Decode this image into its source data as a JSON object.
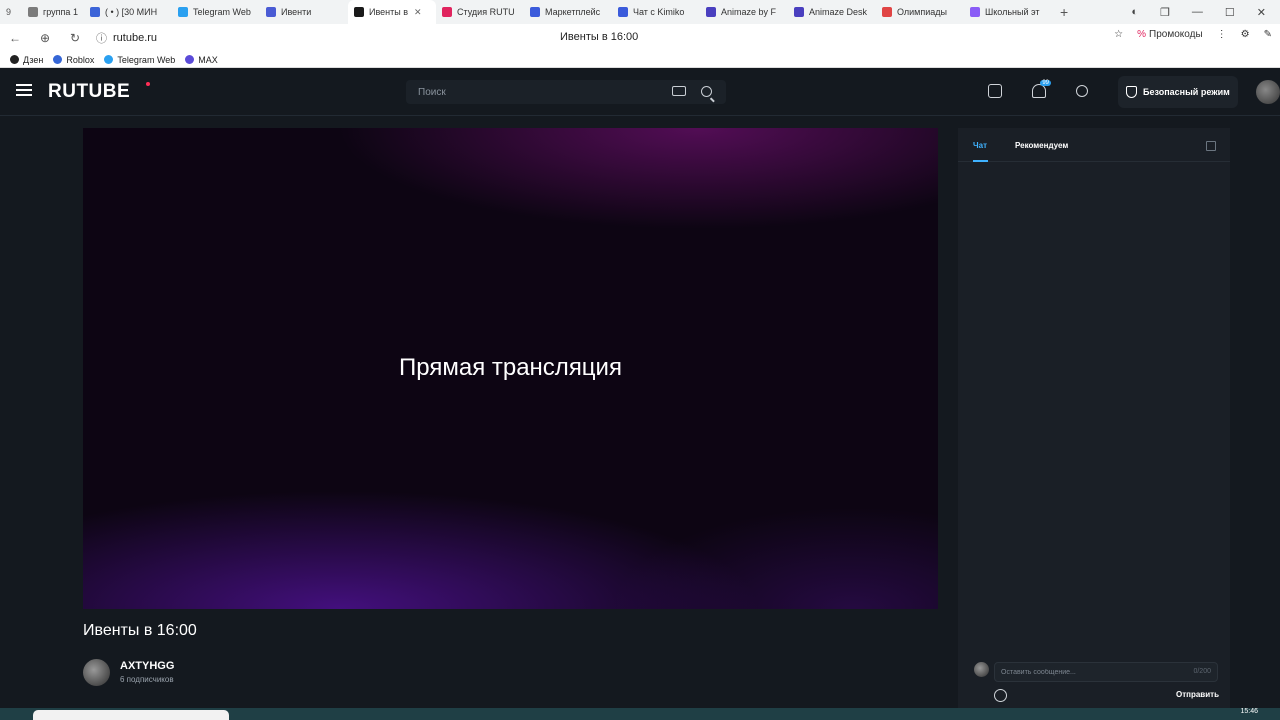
{
  "browser": {
    "tabs": [
      {
        "label": "группа 1",
        "color": "#7b7b7b"
      },
      {
        "label": "( • ) [30 МИН",
        "color": "#3c64d8"
      },
      {
        "label": "Telegram Web",
        "color": "#2aa0f0"
      },
      {
        "label": "Ивенти",
        "color": "#4a5bd4"
      },
      {
        "label": "Ивенты в",
        "color": "#1a1a1a",
        "active": true
      },
      {
        "label": "Студия RUTU",
        "color": "#e0245e"
      },
      {
        "label": "Маркетплейс",
        "color": "#3b5bdb"
      },
      {
        "label": "Чат с Kimiko",
        "color": "#3b5bdb"
      },
      {
        "label": "Animaze by F",
        "color": "#4a3fbf"
      },
      {
        "label": "Animaze Desk",
        "color": "#4a3fbf"
      },
      {
        "label": "Олимпиады",
        "color": "#e04444"
      },
      {
        "label": "Школьный эт",
        "color": "#8a5cf6"
      }
    ],
    "url": "rutube.ru",
    "page_title": "Ивенты в 16:00",
    "promo_label": "Промокоды",
    "bookmarks": [
      {
        "label": "Дзен",
        "color": "#222222"
      },
      {
        "label": "Roblox",
        "color": "#3566d6"
      },
      {
        "label": "Telegram Web",
        "color": "#2aa0f0"
      },
      {
        "label": "MAX",
        "color": "#5b4bd8"
      }
    ]
  },
  "header": {
    "logo": "RUTUBE",
    "search_placeholder": "Поиск",
    "notification_badge": "99",
    "safe_mode_label": "Безопасный режим",
    "icons": [
      "upload-icon",
      "bell-icon",
      "sun-icon",
      "shield-icon"
    ]
  },
  "player": {
    "overlay_text": "Прямая трансляция"
  },
  "video": {
    "title": "Ивенты в 16:00",
    "channel_name": "AXTYHGG",
    "subscribers": "6 подписчиков"
  },
  "chat": {
    "tab_chat": "Чат",
    "tab_recommended": "Рекомендуем",
    "input_placeholder": "Оставить сообщение...",
    "char_count": "0/200",
    "send_label": "Отправить"
  },
  "taskbar": {
    "clock": "15:46"
  }
}
